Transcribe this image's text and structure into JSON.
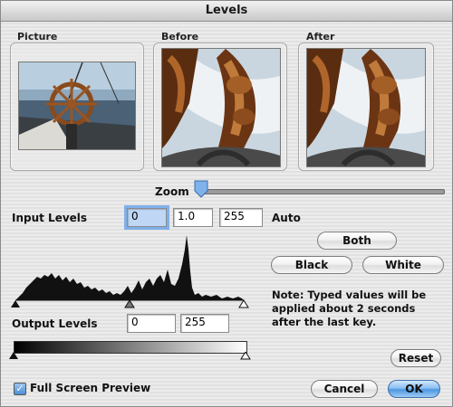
{
  "window": {
    "title": "Levels"
  },
  "panels": {
    "picture": "Picture",
    "before": "Before",
    "after": "After"
  },
  "zoom": {
    "label": "Zoom",
    "value": 0.0
  },
  "input_levels": {
    "label": "Input Levels",
    "black": "0",
    "gamma": "1.0",
    "white": "255",
    "auto_label": "Auto"
  },
  "buttons": {
    "both": "Both",
    "black": "Black",
    "white": "White",
    "reset": "Reset",
    "cancel": "Cancel",
    "ok": "OK"
  },
  "note": {
    "line1": "Note: Typed values will be",
    "line2": "applied about 2 seconds",
    "line3": "after the last key."
  },
  "output_levels": {
    "label": "Output Levels",
    "low": "0",
    "high": "255"
  },
  "preview": {
    "label": "Full Screen Preview",
    "checked": true
  },
  "colors": {
    "focus": "#7fb0ea",
    "ok_button": "#4d97e2",
    "histogram": "#111111"
  }
}
